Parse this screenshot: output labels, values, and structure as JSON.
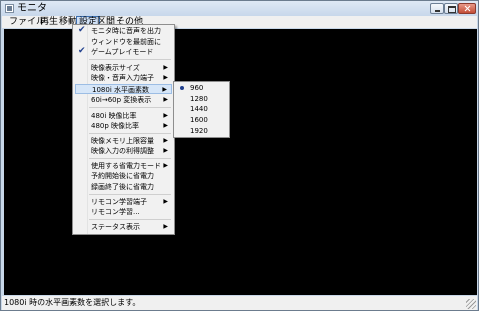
{
  "window": {
    "title": "モニタ"
  },
  "menubar": [
    {
      "label": "ファイル"
    },
    {
      "label": "再生"
    },
    {
      "label": "移動"
    },
    {
      "label": "設定"
    },
    {
      "label": "区間"
    },
    {
      "label": "その他"
    }
  ],
  "settings_menu": {
    "items": [
      {
        "label": "モニタ時に音声を出力",
        "checked": true
      },
      {
        "label": "ウィンドウを最前面に"
      },
      {
        "label": "ゲームプレイモード",
        "checked": true
      },
      {
        "label": "映像表示サイズ",
        "submenu": true
      },
      {
        "label": "映像・音声入力端子",
        "submenu": true
      },
      {
        "label": "1080i 水平画素数",
        "submenu": true
      },
      {
        "label": "60i→60p 変換表示",
        "submenu": true
      },
      {
        "label": "480i 映像比率",
        "submenu": true
      },
      {
        "label": "480p 映像比率",
        "submenu": true
      },
      {
        "label": "映像メモリ上限容量",
        "submenu": true
      },
      {
        "label": "映像入力の利得調整",
        "submenu": true
      },
      {
        "label": "使用する省電力モード",
        "submenu": true
      },
      {
        "label": "予約開始後に省電力"
      },
      {
        "label": "録画終了後に省電力"
      },
      {
        "label": "リモコン学習端子",
        "submenu": true
      },
      {
        "label": "リモコン学習..."
      },
      {
        "label": "ステータス表示",
        "submenu": true
      }
    ]
  },
  "pixel_submenu": {
    "selected": "960",
    "options": [
      "960",
      "1280",
      "1440",
      "1600",
      "1920"
    ]
  },
  "status": {
    "text": "1080i 時の水平画素数を選択します。"
  },
  "colors": {
    "viewport": "#000000",
    "highlight": "#d6e6f8",
    "accent": "#3c6fb0"
  }
}
